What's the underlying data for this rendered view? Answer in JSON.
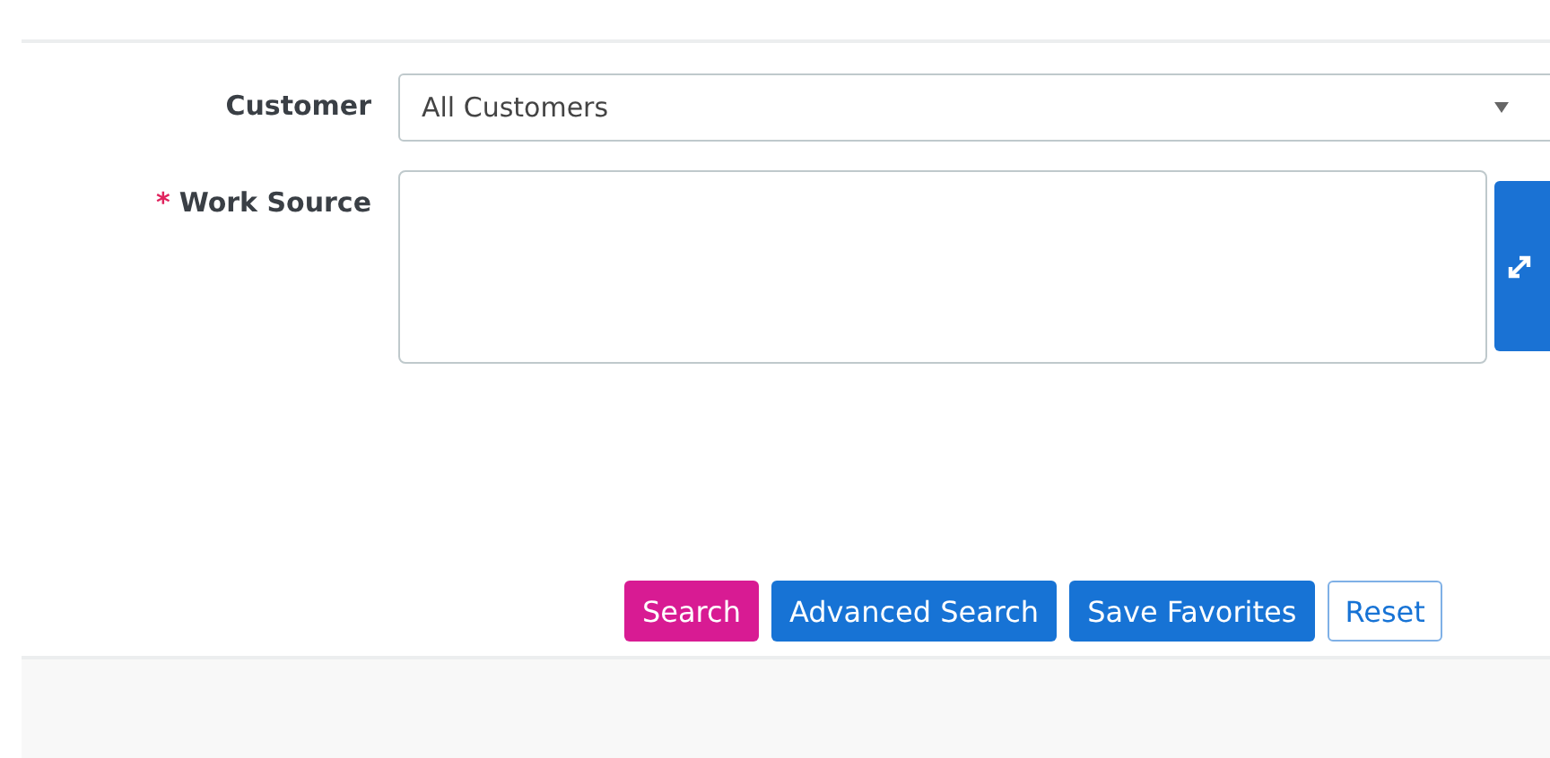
{
  "fields": [
    {
      "kind": "select",
      "label": "Customer",
      "value": "All Customers"
    },
    {
      "kind": "textarea",
      "label": "Work Source",
      "required_marker": "*"
    }
  ],
  "buttons": [
    {
      "label": "Search",
      "kind": "accent"
    },
    {
      "label": "Advanced Search",
      "kind": "primary"
    },
    {
      "label": "Save Favorites",
      "kind": "primary"
    },
    {
      "label": "Reset",
      "kind": "outline"
    }
  ]
}
